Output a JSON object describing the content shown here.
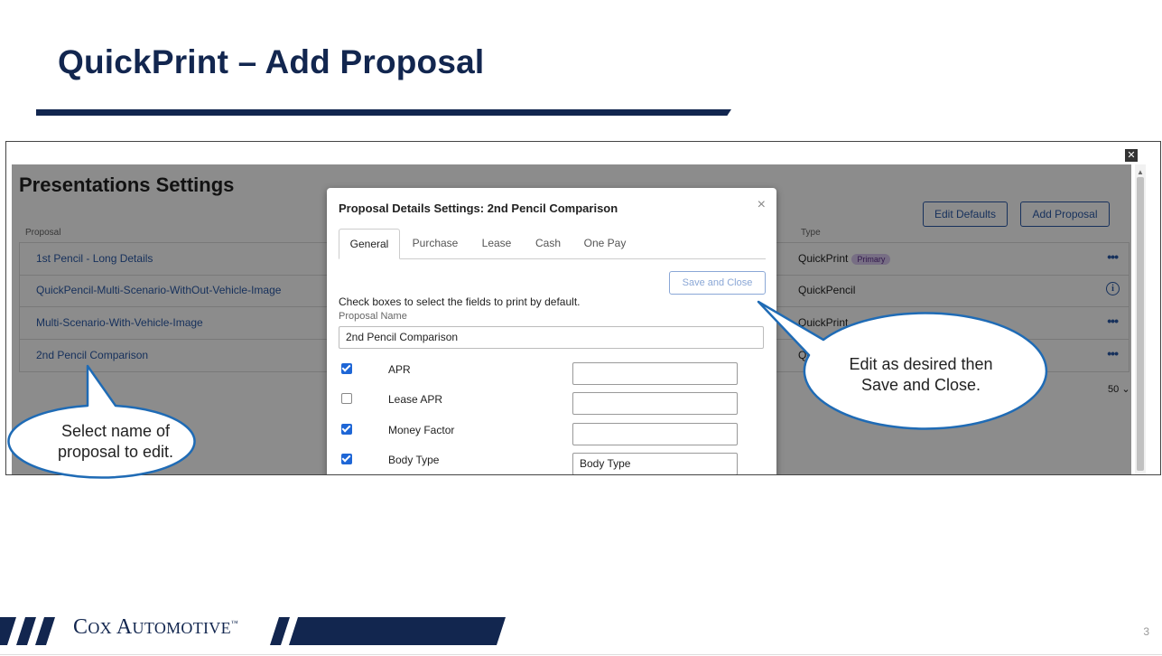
{
  "slide": {
    "title": "QuickPrint – Add Proposal",
    "page_number": "3"
  },
  "brand": {
    "big1": "C",
    "small1": "OX",
    "big2": "A",
    "small2": "UTOMOTIVE",
    "mark": "™",
    "color": "#12264f"
  },
  "app": {
    "title": "Presentations Settings",
    "close_glyph": "✕",
    "columns": {
      "proposal": "Proposal",
      "type": "Type"
    },
    "buttons": {
      "edit_defaults": "Edit Defaults",
      "add_proposal": "Add Proposal"
    },
    "rows": [
      {
        "name": "1st Pencil - Long Details",
        "type": "QuickPrint",
        "badge": "Primary",
        "action_icon": "more-horizontal-icon"
      },
      {
        "name": "QuickPencil-Multi-Scenario-WithOut-Vehicle-Image",
        "type": "QuickPencil",
        "badge": "",
        "action_icon": "info-icon"
      },
      {
        "name": "Multi-Scenario-With-Vehicle-Image",
        "type": "QuickPrint",
        "badge": "",
        "action_icon": "more-horizontal-icon"
      },
      {
        "name": "2nd Pencil Comparison",
        "type": "QuickPrint",
        "badge": "",
        "action_icon": "more-horizontal-icon"
      }
    ],
    "page_size": "50"
  },
  "modal": {
    "title": "Proposal Details Settings: 2nd Pencil Comparison",
    "close_glyph": "×",
    "tabs": [
      "General",
      "Purchase",
      "Lease",
      "Cash",
      "One Pay"
    ],
    "active_tab": "General",
    "save_label": "Save and Close",
    "instructions": "Check boxes to select the fields to print by default.",
    "proposal_name_label": "Proposal Name",
    "proposal_name_value": "2nd Pencil Comparison",
    "options": [
      {
        "label": "APR",
        "checked": true,
        "value": ""
      },
      {
        "label": "Lease APR",
        "checked": false,
        "value": ""
      },
      {
        "label": "Money Factor",
        "checked": true,
        "value": ""
      },
      {
        "label": "Body Type",
        "checked": true,
        "value": "Body Type"
      }
    ]
  },
  "callouts": {
    "left_line1": "Select name of",
    "left_line2": "proposal to edit.",
    "right_line1": "Edit as desired then",
    "right_line2": "Save and Close."
  },
  "colors": {
    "navy": "#12264f",
    "link_blue": "#2b5aa8",
    "callout_border": "#1f6bb5",
    "checkbox_blue": "#1e66d6"
  }
}
